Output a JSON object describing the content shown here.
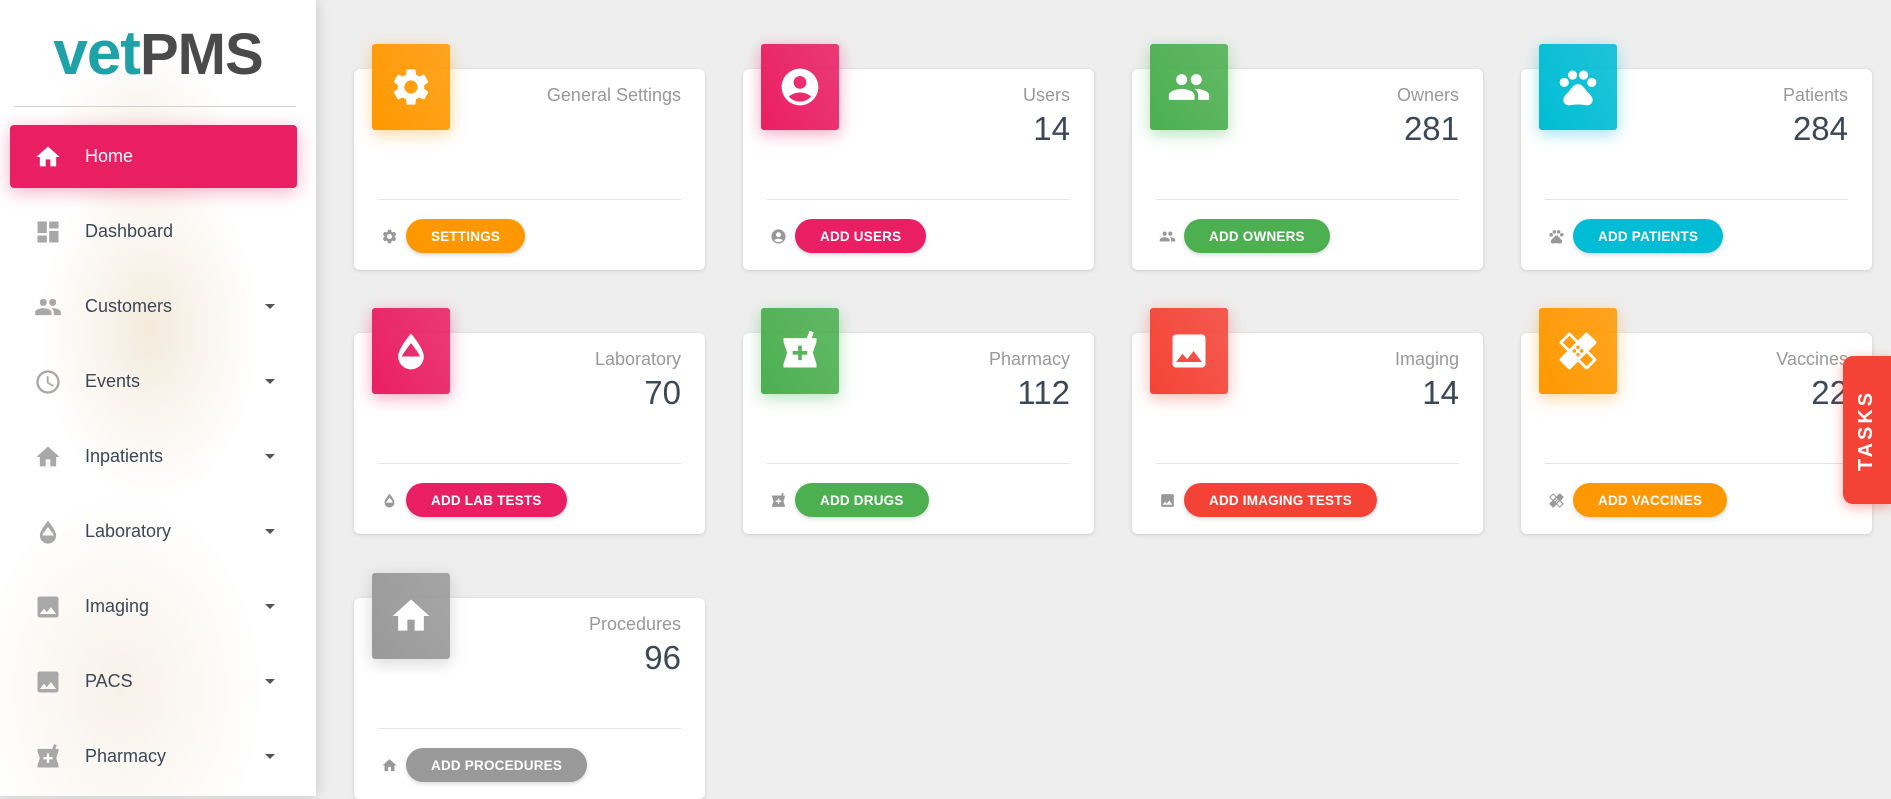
{
  "app": {
    "logo_part1": "vet",
    "logo_part2": "PMS"
  },
  "sidebar": {
    "items": [
      {
        "label": "Home",
        "icon": "home-icon",
        "active": true
      },
      {
        "label": "Dashboard",
        "icon": "dashboard-icon"
      },
      {
        "label": "Customers",
        "icon": "people-icon",
        "caret": true
      },
      {
        "label": "Events",
        "icon": "clock-icon",
        "caret": true
      },
      {
        "label": "Inpatients",
        "icon": "home-icon",
        "caret": true
      },
      {
        "label": "Laboratory",
        "icon": "drop-icon",
        "caret": true
      },
      {
        "label": "Imaging",
        "icon": "image-icon",
        "caret": true
      },
      {
        "label": "PACS",
        "icon": "image-icon",
        "caret": true
      },
      {
        "label": "Pharmacy",
        "icon": "pharmacy-icon",
        "caret": true
      }
    ]
  },
  "colors": {
    "pink": "#e91e63",
    "orange": "#ff9800",
    "green": "#4caf50",
    "cyan": "#00bcd4",
    "red": "#f44336",
    "grey": "#999999"
  },
  "cards": [
    {
      "title": "General Settings",
      "value": "",
      "button": "SETTINGS",
      "icon": "gear-icon",
      "color": "#ff9800"
    },
    {
      "title": "Users",
      "value": "14",
      "button": "ADD USERS",
      "icon": "account-icon",
      "color": "#e91e63"
    },
    {
      "title": "Owners",
      "value": "281",
      "button": "ADD OWNERS",
      "icon": "people-icon",
      "color": "#4caf50"
    },
    {
      "title": "Patients",
      "value": "284",
      "button": "ADD PATIENTS",
      "icon": "paw-icon",
      "color": "#00bcd4"
    },
    {
      "title": "Laboratory",
      "value": "70",
      "button": "ADD LAB TESTS",
      "icon": "drop-icon",
      "color": "#e91e63"
    },
    {
      "title": "Pharmacy",
      "value": "112",
      "button": "ADD DRUGS",
      "icon": "pharmacy-icon",
      "color": "#4caf50"
    },
    {
      "title": "Imaging",
      "value": "14",
      "button": "ADD IMAGING TESTS",
      "icon": "image-icon",
      "color": "#f44336"
    },
    {
      "title": "Vaccines",
      "value": "22",
      "button": "ADD VACCINES",
      "icon": "bandage-icon",
      "color": "#ff9800"
    },
    {
      "title": "Procedures",
      "value": "96",
      "button": "ADD PROCEDURES",
      "icon": "home-icon",
      "color": "#999999"
    }
  ],
  "tasks_tab": {
    "label": "TASKS"
  }
}
